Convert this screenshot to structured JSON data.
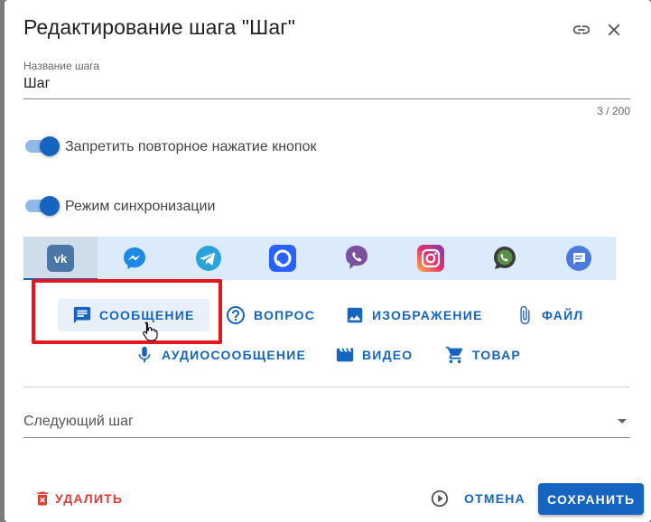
{
  "dialog": {
    "title": "Редактирование шага \"Шаг\"",
    "link_icon": "link-icon",
    "close_icon": "close-icon"
  },
  "step_name": {
    "label": "Название шага",
    "value": "Шаг",
    "counter": "3 / 200"
  },
  "toggles": [
    {
      "label": "Запретить повторное нажатие кнопок",
      "on": true
    },
    {
      "label": "Режим синхронизации",
      "on": true
    }
  ],
  "channel_tabs": [
    {
      "name": "vk",
      "icon": "vk-icon",
      "active": true
    },
    {
      "name": "messenger",
      "icon": "messenger-icon"
    },
    {
      "name": "telegram",
      "icon": "telegram-icon"
    },
    {
      "name": "max",
      "icon": "chat-app-icon"
    },
    {
      "name": "viber",
      "icon": "viber-icon"
    },
    {
      "name": "instagram",
      "icon": "instagram-icon"
    },
    {
      "name": "whatsapp",
      "icon": "whatsapp-icon"
    },
    {
      "name": "chat",
      "icon": "chat-bubble-icon"
    }
  ],
  "content_buttons": {
    "message": "СООБЩЕНИЕ",
    "question": "ВОПРОС",
    "image": "ИЗОБРАЖЕНИЕ",
    "file": "ФАЙЛ",
    "audio": "АУДИОСООБЩЕНИЕ",
    "video": "ВИДЕО",
    "product": "ТОВАР"
  },
  "next_step": {
    "placeholder": "Следующий шаг"
  },
  "footer": {
    "delete": "УДАЛИТЬ",
    "cancel": "ОТМЕНА",
    "save": "СОХРАНИТЬ"
  },
  "colors": {
    "accent": "#1565c0",
    "danger": "#e53935",
    "highlight": "#e5161d",
    "tab_bar": "#dcebfb"
  }
}
